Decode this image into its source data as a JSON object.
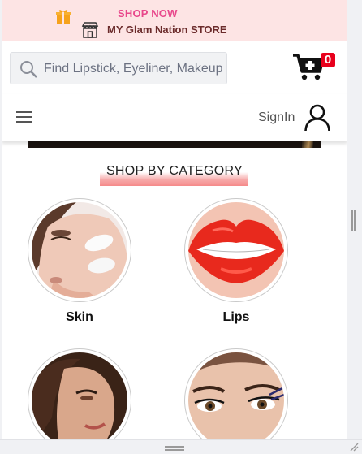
{
  "promo": {
    "headline": "SHOP NOW",
    "store_name": "MY Glam Nation STORE",
    "icons": [
      "gift-icon",
      "store-icon"
    ]
  },
  "search": {
    "placeholder": "Find Lipstick, Eyeliner, Makeup"
  },
  "cart": {
    "count": "0",
    "icon": "cart-plus-icon"
  },
  "nav": {
    "signin_label": "SignIn",
    "icons": [
      "hamburger-menu-icon",
      "user-icon"
    ]
  },
  "section": {
    "title": "SHOP BY CATEGORY"
  },
  "categories": [
    {
      "label": "Skin"
    },
    {
      "label": "Lips"
    },
    {
      "label": ""
    },
    {
      "label": ""
    }
  ],
  "colors": {
    "promo_bg": "#fde4e4",
    "shop_now": "#e8478b",
    "store_text": "#6b2b2b",
    "badge": "#e8001c",
    "accent_underline": "#f58a8a"
  }
}
